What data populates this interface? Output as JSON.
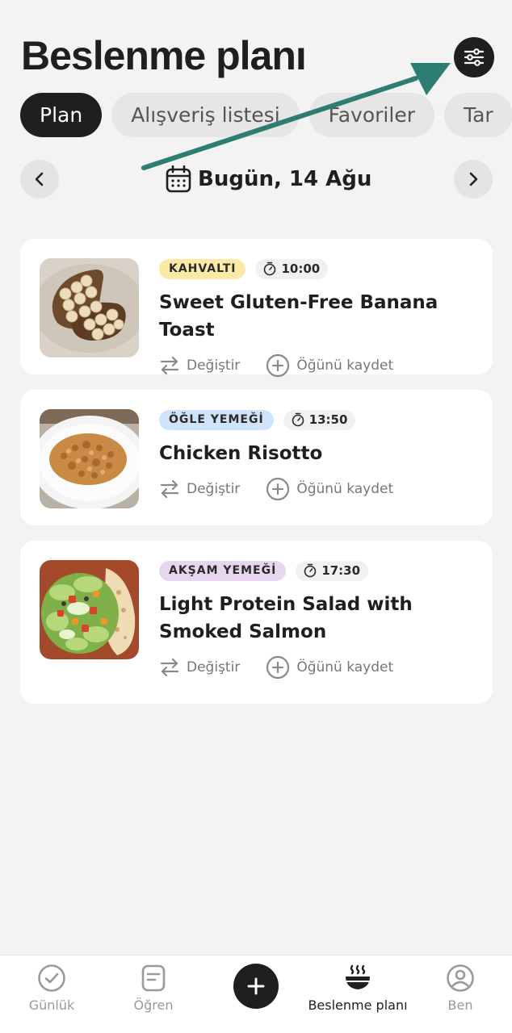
{
  "header": {
    "title": "Beslenme planı",
    "filter_icon": "sliders-icon"
  },
  "tabs": [
    {
      "label": "Plan",
      "active": true
    },
    {
      "label": "Alışveriş listesi",
      "active": false
    },
    {
      "label": "Favoriler",
      "active": false
    },
    {
      "label": "Tar",
      "active": false
    }
  ],
  "date_nav": {
    "label": "Bugün, 14 Ağu",
    "prev_icon": "chevron-left-icon",
    "next_icon": "chevron-right-icon",
    "calendar_icon": "calendar-icon"
  },
  "meals": [
    {
      "tag": "KAHVALTI",
      "tag_color": "#fbe9a6",
      "time": "10:00",
      "title": "Sweet Gluten-Free Banana Toast",
      "swap_label": "Değiştir",
      "log_label": "Öğünü kaydet"
    },
    {
      "tag": "ÖĞLE YEMEĞİ",
      "tag_color": "#cfe4fa",
      "time": "13:50",
      "title": "Chicken Risotto",
      "swap_label": "Değiştir",
      "log_label": "Öğünü kaydet"
    },
    {
      "tag": "AKŞAM YEMEĞİ",
      "tag_color": "#e7d7ee",
      "time": "17:30",
      "title": "Light Protein Salad with Smoked Salmon",
      "swap_label": "Değiştir",
      "log_label": "Öğünü kaydet"
    }
  ],
  "bottom_nav": {
    "items": [
      {
        "label": "Günlük",
        "icon": "check-circle-icon"
      },
      {
        "label": "Öğren",
        "icon": "note-icon"
      },
      {
        "label": "Beslenme planı",
        "icon": "bowl-icon",
        "active": true
      },
      {
        "label": "Ben",
        "icon": "profile-icon"
      }
    ],
    "add_icon": "plus-icon"
  },
  "colors": {
    "accent_dark": "#1f1f1f",
    "annotation_arrow": "#2e7d72",
    "background": "#f3f3f3"
  }
}
